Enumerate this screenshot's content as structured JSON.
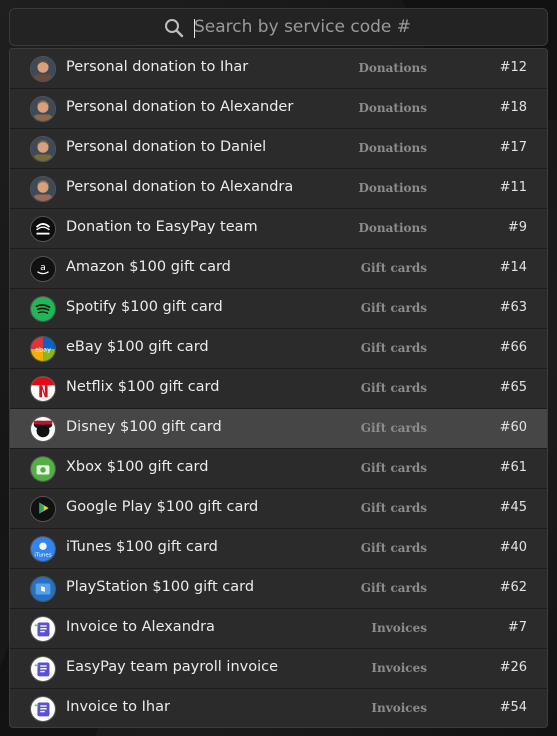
{
  "search": {
    "placeholder": "Search by service code #",
    "value": ""
  },
  "results": [
    {
      "title": "Personal donation to Ihar",
      "category": "Donations",
      "code": "#12",
      "icon": "person-ihar-avatar",
      "color": "#6b4a3a"
    },
    {
      "title": "Personal donation to Alexander",
      "category": "Donations",
      "code": "#18",
      "icon": "person-alexander-avatar",
      "color": "#8a6a4a"
    },
    {
      "title": "Personal donation to Daniel",
      "category": "Donations",
      "code": "#17",
      "icon": "person-daniel-avatar",
      "color": "#7a6a3a"
    },
    {
      "title": "Personal donation to Alexandra",
      "category": "Donations",
      "code": "#11",
      "icon": "person-alexandra-avatar",
      "color": "#9a6a5a"
    },
    {
      "title": "Donation to EasyPay team",
      "category": "Donations",
      "code": "#9",
      "icon": "easypay-logo-icon",
      "color": "#111111"
    },
    {
      "title": "Amazon $100 gift card",
      "category": "Gift cards",
      "code": "#14",
      "icon": "amazon-logo-icon",
      "color": "#111111"
    },
    {
      "title": "Spotify $100 gift card",
      "category": "Gift cards",
      "code": "#63",
      "icon": "spotify-logo-icon",
      "color": "#1db954"
    },
    {
      "title": "eBay $100 gift card",
      "category": "Gift cards",
      "code": "#66",
      "icon": "ebay-logo-icon",
      "color": "#e53238"
    },
    {
      "title": "Netflix $100 gift card",
      "category": "Gift cards",
      "code": "#65",
      "icon": "netflix-logo-icon",
      "color": "#e50914"
    },
    {
      "title": "Disney $100 gift card",
      "category": "Gift cards",
      "code": "#60",
      "icon": "disney-logo-icon",
      "color": "#c8102e"
    },
    {
      "title": "Xbox $100 gift card",
      "category": "Gift cards",
      "code": "#61",
      "icon": "xbox-logo-icon",
      "color": "#52b043"
    },
    {
      "title": "Google Play $100 gift card",
      "category": "Gift cards",
      "code": "#45",
      "icon": "google-play-logo-icon",
      "color": "#111111"
    },
    {
      "title": "iTunes $100 gift card",
      "category": "Gift cards",
      "code": "#40",
      "icon": "itunes-logo-icon",
      "color": "#2e86f5"
    },
    {
      "title": "PlayStation $100 gift card",
      "category": "Gift cards",
      "code": "#62",
      "icon": "playstation-logo-icon",
      "color": "#2173c8"
    },
    {
      "title": "Invoice to Alexandra",
      "category": "Invoices",
      "code": "#7",
      "icon": "invoice-icon",
      "color": "#5a4fd6"
    },
    {
      "title": "EasyPay team payroll invoice",
      "category": "Invoices",
      "code": "#26",
      "icon": "invoice-icon",
      "color": "#5a4fd6"
    },
    {
      "title": "Invoice to Ihar",
      "category": "Invoices",
      "code": "#54",
      "icon": "invoice-icon",
      "color": "#5a4fd6"
    }
  ],
  "highlighted_index": 9
}
